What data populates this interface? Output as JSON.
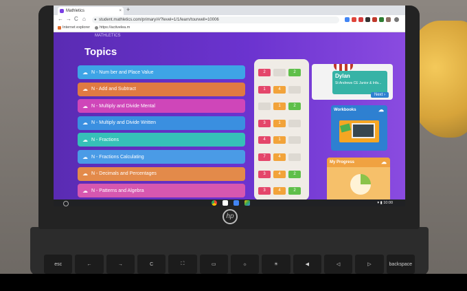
{
  "browser": {
    "tab_title": "Mathletics",
    "tab_close": "×",
    "new_tab": "+",
    "url": "student.mathletics.com/primary/#/?level=1/1/learn/tourwell=10006",
    "nav": {
      "back": "←",
      "forward": "→",
      "reload": "C",
      "home": "⌂"
    },
    "bookmarks": [
      "Internet explorer",
      "https://activelea.m"
    ]
  },
  "page": {
    "topics_heading": "Topics",
    "top_fragment": "MATHLETICS",
    "topics": [
      {
        "label": "N - Num ber and Place Value",
        "color": "#3ea4e6"
      },
      {
        "label": "N - Add and Subtract",
        "color": "#e07a42"
      },
      {
        "label": "N - Multiply and Divide Mental",
        "color": "#cf46b9"
      },
      {
        "label": "N - Multiply and Divide Written",
        "color": "#3a8fe0"
      },
      {
        "label": "N - Fractions",
        "color": "#36c0b8"
      },
      {
        "label": "N - Fractions Calculating",
        "color": "#4a9be6"
      },
      {
        "label": "N - Decimals and Percentages",
        "color": "#e38a4a"
      },
      {
        "label": "N - Patterns and Algebra",
        "color": "#d657b0"
      }
    ],
    "scores": [
      [
        "2",
        "",
        "2"
      ],
      [
        "1",
        "4",
        ""
      ],
      [
        "",
        "1",
        "2"
      ],
      [
        "3",
        "1",
        ""
      ],
      [
        "4",
        "1",
        ""
      ],
      [
        "7",
        "4",
        ""
      ],
      [
        "3",
        "4",
        "2"
      ],
      [
        "3",
        "4",
        "2"
      ]
    ],
    "student": {
      "name": "Dylan",
      "school": "St Andrews CE Junior & Infa...",
      "next_button": "Next"
    },
    "workbooks_title": "Workbooks",
    "progress_title": "My Progress"
  },
  "shelf": {
    "time": "10:00"
  },
  "laptop": {
    "brand": "hp",
    "keys": [
      "esc",
      "←",
      "→",
      "C",
      "⛶",
      "▭",
      "☼",
      "☀",
      "◀",
      "◁",
      "▷",
      "backspace"
    ]
  },
  "colors": {
    "page_purple": "#5a2bb3",
    "card_blue": "#2e80d1",
    "chip_red": "#e4466a",
    "chip_orange": "#f2a33a",
    "chip_green": "#5fbf4a"
  }
}
